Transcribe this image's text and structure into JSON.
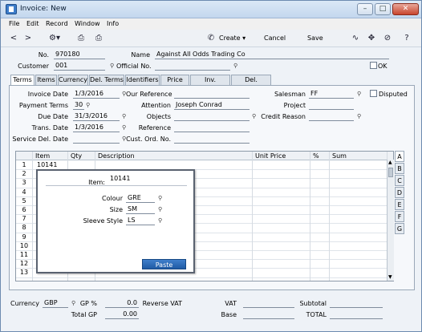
{
  "window": {
    "title": "Invoice: New",
    "min": "–",
    "max": "□",
    "close": "✕"
  },
  "menu": [
    "File",
    "Edit",
    "Record",
    "Window",
    "Info"
  ],
  "toolbar": {
    "create": "Create",
    "cancel": "Cancel",
    "save": "Save"
  },
  "header": {
    "no_label": "No.",
    "no_value": "970180",
    "name_label": "Name",
    "name_value": "Against All Odds Trading Co",
    "customer_label": "Customer",
    "customer_value": "001",
    "official_label": "Official No.",
    "official_value": "",
    "ok_label": "OK"
  },
  "tabs": [
    "Terms",
    "Items",
    "Currency",
    "Del. Terms",
    "Identifiers",
    "Price List",
    "Inv. Address",
    "Del. Address"
  ],
  "terms": {
    "invoice_date_label": "Invoice Date",
    "invoice_date": "1/3/2016",
    "our_ref_label": "Our Reference",
    "our_ref": "",
    "salesman_label": "Salesman",
    "salesman": "FF",
    "disputed_label": "Disputed",
    "payment_terms_label": "Payment Terms",
    "payment_terms": "30",
    "attention_label": "Attention",
    "attention": "Joseph Conrad",
    "project_label": "Project",
    "project": "",
    "due_date_label": "Due Date",
    "due_date": "31/3/2016",
    "objects_label": "Objects",
    "objects": "",
    "credit_reason_label": "Credit Reason",
    "credit_reason": "",
    "trans_date_label": "Trans. Date",
    "trans_date": "1/3/2016",
    "reference_label": "Reference",
    "reference": "",
    "service_del_label": "Service Del. Date",
    "service_del": "",
    "cust_ord_label": "Cust. Ord. No.",
    "cust_ord": ""
  },
  "grid": {
    "headers": [
      "Item",
      "Qty",
      "Description",
      "Unit Price",
      "%",
      "Sum"
    ],
    "rows": [
      "1",
      "2",
      "3",
      "4",
      "5",
      "6",
      "7",
      "8",
      "9",
      "10",
      "11",
      "12",
      "13"
    ],
    "first_item": "10141"
  },
  "side_tabs": [
    "A",
    "B",
    "C",
    "D",
    "E",
    "F",
    "G"
  ],
  "popup": {
    "item_label": "Item:",
    "item_value": "10141",
    "colour_label": "Colour",
    "colour_value": "GRE",
    "size_label": "Size",
    "size_value": "SM",
    "sleeve_label": "Sleeve Style",
    "sleeve_value": "LS",
    "paste_label": "Paste"
  },
  "footer": {
    "currency_label": "Currency",
    "currency": "GBP",
    "gp_pct_label": "GP %",
    "gp_pct": "0.0",
    "reverse_vat_label": "Reverse VAT",
    "vat_label": "VAT",
    "vat": "",
    "subtotal_label": "Subtotal",
    "subtotal": "",
    "total_gp_label": "Total GP",
    "total_gp": "0.00",
    "base_label": "Base",
    "base": "",
    "total_label": "TOTAL",
    "total": ""
  }
}
